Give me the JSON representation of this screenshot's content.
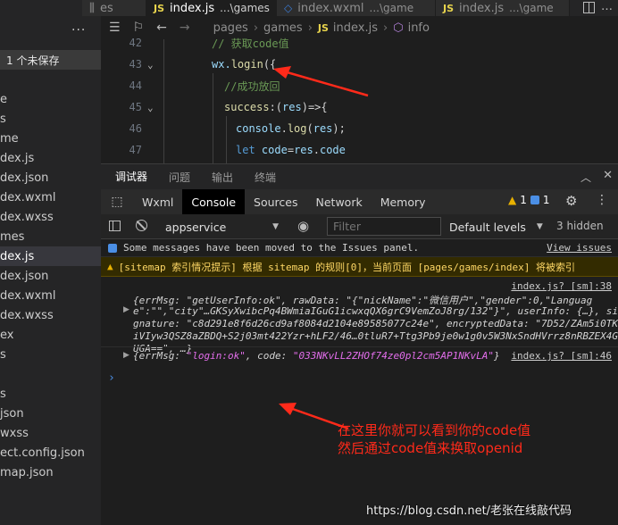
{
  "tabs": [
    {
      "name": "es",
      "dir": ""
    },
    {
      "name": "index.js",
      "dir": "...\\games",
      "modified": true
    },
    {
      "name": "index.wxml",
      "dir": "...\\game"
    },
    {
      "name": "index.js",
      "dir": "...\\game"
    }
  ],
  "sidebar": {
    "unsaved": "1 个未保存",
    "files": [
      "e",
      "s",
      "me",
      "dex.js",
      "dex.json",
      "dex.wxml",
      "dex.wxss",
      "mes",
      "dex.js",
      "dex.json",
      "dex.wxml",
      "dex.wxss",
      "ex",
      "s",
      "",
      "s",
      "json",
      "wxss",
      "ect.config.json",
      "map.json"
    ]
  },
  "breadcrumb": [
    "pages",
    "games",
    "index.js",
    "info"
  ],
  "code": {
    "lines": [
      {
        "num": "42",
        "text": "// 获取code值"
      },
      {
        "num": "43",
        "text": "wx.login({"
      },
      {
        "num": "44",
        "text": "//成功放回"
      },
      {
        "num": "45",
        "text": "success:(res)=>{"
      },
      {
        "num": "46",
        "text": "console.log(res);"
      },
      {
        "num": "47",
        "text": "let code=res.code"
      }
    ],
    "tokens": {
      "l43_a": "wx.",
      "l43_b": "login",
      "l43_c": "({",
      "l45_a": "success",
      "l45_b": ":(",
      "l45_c": "res",
      "l45_d": ")=>{",
      "l46_a": "console",
      "l46_b": ".",
      "l46_c": "log",
      "l46_d": "(",
      "l46_e": "res",
      "l46_f": ");",
      "l47_a": "let",
      "l47_b": "code",
      "l47_c": "=",
      "l47_d": "res",
      "l47_e": ".",
      "l47_f": "code"
    }
  },
  "panel": {
    "tabs": [
      "调试器",
      "问题",
      "输出",
      "终端"
    ],
    "devtools_tabs": [
      "Wxml",
      "Console",
      "Sources",
      "Network",
      "Memory"
    ],
    "warn_count": "1",
    "info_count": "1",
    "context": "appservice",
    "filter_placeholder": "Filter",
    "levels": "Default levels",
    "hidden": "3 hidden"
  },
  "console": {
    "info_message": "Some messages have been moved to the Issues panel.",
    "info_link": "View issues",
    "warn_message": "[sitemap 索引情况提示] 根据 sitemap 的规则[0]，当前页面 [pages/games/index] 将被索引",
    "log1": {
      "source": "index.js? [sm]:38",
      "line1": "{errMsg: \"getUserInfo:ok\", rawData: \"{\"nickName\":\"微信用户\",\"gender\":0,\"Languag",
      "line2": "e\":\"\",\"city\"…GKSyXwibcPq4BWmiaIGuG1icwxqQX6grC9VemZoJ8rg/132\"}\", userInfo: {…}, si",
      "line3": "gnature: \"c8d291e8f6d26cd9af8084d2104e89585077c24e\", encryptedData: \"7D52/ZAm5i0TK",
      "line4": "iVIyw3QSZ8aZBDQ+S2j03mt422Yzr+hLF2/46…0tluR7+Ttg3Pb9je0w1g0v5W3NxSndHVrrz8nRBZEX4G",
      "line5": "UGA==\", …}"
    },
    "log2": {
      "source": "index.js? [sm]:46",
      "key1": "errMsg",
      "val1": "\"login:ok\"",
      "key2": "code",
      "val2": "\"033NKvLL2ZHOf74ze0pl2cm5AP1NKvLA\""
    }
  },
  "annotation": {
    "line1": "在这里你就可以看到你的code值",
    "line2": "然后通过code值来换取openid"
  },
  "watermark": "https://blog.csdn.net/老张在线敲代码",
  "colors": {
    "annotation": "#ff2a1a",
    "accent": "#4b8fe5",
    "warning": "#e8b100"
  }
}
